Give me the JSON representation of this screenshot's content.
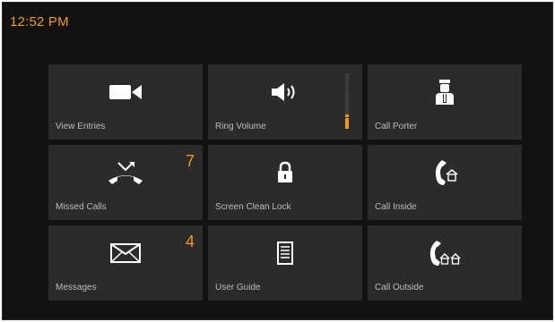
{
  "colors": {
    "accent": "#f39a1b",
    "tile": "#2b2b2b",
    "background": "#121212"
  },
  "status": {
    "time": "12:52 PM"
  },
  "tiles": {
    "view_entries": {
      "label": "View Entries",
      "icon": "video-camera-icon"
    },
    "ring_volume": {
      "label": "Ring Volume",
      "icon": "speaker-icon",
      "level_fraction": 0.25
    },
    "call_porter": {
      "label": "Call Porter",
      "icon": "porter-icon"
    },
    "missed_calls": {
      "label": "Missed Calls",
      "icon": "missed-call-icon",
      "badge": "7"
    },
    "screen_clean_lock": {
      "label": "Screen Clean Lock",
      "icon": "padlock-icon"
    },
    "call_inside": {
      "label": "Call Inside",
      "icon": "phone-home-icon"
    },
    "messages": {
      "label": "Messages",
      "icon": "envelope-icon",
      "badge": "4"
    },
    "user_guide": {
      "label": "User Guide",
      "icon": "document-icon"
    },
    "call_outside": {
      "label": "Call Outside",
      "icon": "phone-outside-icon"
    }
  }
}
